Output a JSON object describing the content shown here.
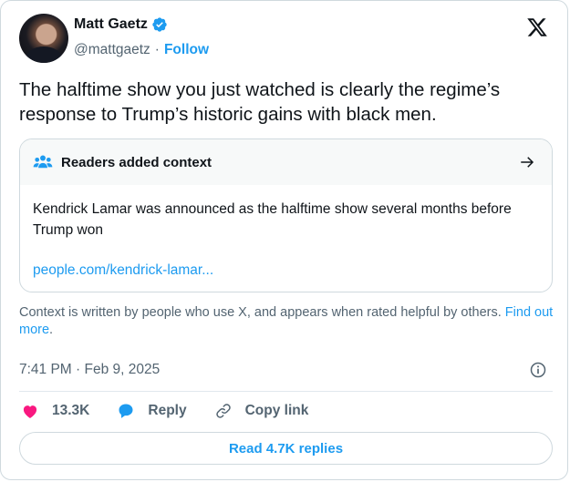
{
  "author": {
    "name": "Matt Gaetz",
    "handle": "@mattgaetz",
    "separator": "·",
    "follow_label": "Follow"
  },
  "tweet": {
    "text": "The halftime show you just watched is clearly the regime’s response to Trump’s historic gains with black men."
  },
  "context_note": {
    "title": "Readers added context",
    "body": "Kendrick Lamar was announced as the halftime show several months before Trump won",
    "link": "people.com/kendrick-lamar..."
  },
  "context_footer": {
    "text": "Context is written by people who use X, and appears when rated helpful by others.",
    "link": "Find out more",
    "suffix": "."
  },
  "meta": {
    "timestamp": "7:41 PM · Feb 9, 2025"
  },
  "actions": {
    "likes": "13.3K",
    "reply_label": "Reply",
    "copy_label": "Copy link"
  },
  "replies_button": "Read 4.7K replies",
  "colors": {
    "accent": "#1d9bf0",
    "like": "#f91880",
    "text": "#0f1419",
    "muted": "#536471"
  },
  "icons": [
    "verified-badge-icon",
    "x-logo-icon",
    "people-icon",
    "arrow-right-icon",
    "info-icon",
    "heart-icon",
    "reply-bubble-icon",
    "link-icon"
  ]
}
